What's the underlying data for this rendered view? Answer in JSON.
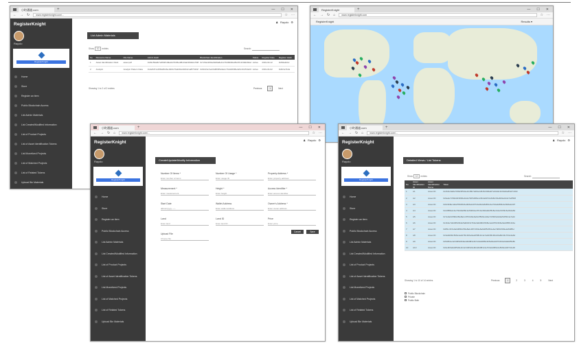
{
  "browser": {
    "tab_title": "小町通道.com",
    "tab_title_map": "RegisterKnight",
    "url_main": "www.registerknight.com/...",
    "url_map": "www.registerknight.com",
    "window_controls": [
      "—",
      "☐",
      "✕"
    ]
  },
  "app": {
    "brand": "RegisterKnight",
    "username": "Rayolo",
    "register_button": "RegisterKnight",
    "user_menu": "Rayolo"
  },
  "nav_left": [
    "Home",
    "Store",
    "Register an item",
    "Public Blockchain Access",
    "List Admin Materials",
    "List Created/Modified Information",
    "List of Product Projects",
    "List of Asset Identification Tokens",
    "List Monetized Projects",
    "List of Matched Projects",
    "List of Related Tokens",
    "Upload Bin Materials"
  ],
  "nav_bottom": [
    "Home",
    "Store",
    "Register an item",
    "Public Blockchain Access",
    "List Admin Materials",
    "List Created/Modified Information",
    "List of Product Projects",
    "List of Asset Identification Tokens",
    "List Monetized Projects",
    "List of Matched Projects",
    "List of Related Tokens",
    "Upload Bin Materials"
  ],
  "list_page": {
    "header": "List Admin Materials",
    "show_label": "Show",
    "show_value": "10",
    "entries_label": "entries",
    "search_label": "Search:",
    "columns": [
      "No",
      "Resource Name",
      "File Name",
      "Admin Hash",
      "Blockchain Identification",
      "Status",
      "Register Date",
      "Register Hash"
    ],
    "rows": [
      [
        "1",
        "Asset Identification Pack",
        "asset.pdf",
        "0x81c59a0b7e6f02f1d9a3c27b05e4f8c19ab360d2e7f48a1",
        "0x7c5a12f0be93d6a8e41c7f2d9b60a35e87c1f49d2b6a07e3",
        "Active",
        "2019-03-12",
        "0x5f2a9c1d"
      ],
      [
        "2",
        "Analytic",
        "Analytic Pattern Data",
        "0x3e8d71c2f09a5b46e18d3c7fa92b0e5d64c1a8f7b3029e6d",
        "0x9b1f4e7a2c6d80f35e9a1c7b4d206f8e3a5c19d7b0e6f42a",
        "Active",
        "2019-04-02",
        "0x8c3e7b2a"
      ]
    ],
    "footer_info": "Showing 1 to 2 of 2 entries",
    "pages": [
      "Previous",
      "1",
      "Next"
    ]
  },
  "form_page": {
    "header": "Create/Update/Modify Information",
    "col1": [
      {
        "label": "Number Of Items *",
        "value": "Enter number of items"
      },
      {
        "label": "Measurement *",
        "value": "Enter measurement"
      },
      {
        "label": "Start Date",
        "value": "dd/mm/yyyy --:--"
      },
      {
        "label": "Land",
        "value": "Enter land"
      },
      {
        "label": "Upload File",
        "value": "Choose file"
      }
    ],
    "col2": [
      {
        "label": "Number Of Usage *",
        "value": "Enter usage ID"
      },
      {
        "label": "Height *",
        "value": "Enter height"
      },
      {
        "label": "Wallet Address",
        "value": "Enter wallet address"
      },
      {
        "label": "Land ID",
        "value": "Enter land ID"
      }
    ],
    "col3": [
      {
        "label": "Property Address *",
        "value": "Enter property address"
      },
      {
        "label": "Access Identifier *",
        "value": "Enter access identifier"
      },
      {
        "label": "Owner's Address *",
        "value": "Enter owner address"
      },
      {
        "label": "Price",
        "value": "Enter price"
      }
    ],
    "cancel_label": "Cancel",
    "save_label": "Save"
  },
  "tokens_page": {
    "header": "Detailed Views / List Tokens",
    "show_label": "Show",
    "show_value": "10",
    "entries_label": "entries",
    "search_label": "Search:",
    "columns": [
      "No",
      "Asset Identification ID",
      "Asset Identification Name",
      "Token"
    ],
    "rows": [
      [
        "1",
        "A1",
        "Asset ID",
        "0x4fd1c0a8e7b6923f5d1e0c48b7a9f3e2d615c0b8a4f7e93d2c1b60a5e8f4d7c3b9"
      ],
      [
        "2",
        "A2",
        "Asset ID",
        "0x9a2e7c5b0d4f1836e9c2a7b05d3f8e1c6b4a9072e5d8c3f1a6b9e0d4c7a2f5b8"
      ],
      [
        "3",
        "A3",
        "Asset ID",
        "0x6c3b8e1d4a7f0925c6e3b8a1d4f7c0e9b2a5d8f1c4e7b0a3d6f9c2e5b8a1d4f7"
      ],
      [
        "4",
        "A4",
        "Asset ID",
        "0x2d5f8a1c4e7b0d3a6f9c2e5b8d1a4f7c0e3b6a9d2f5c8e1b4a7d0f3c6e9b2a5d"
      ],
      [
        "5",
        "A5",
        "Asset ID",
        "0x7e0a3c6f9b2d5e8a1c4f7b0d3e6a9c2f5b8e1d4a7c0f3b6e9d2a5c8f1b4e7a0c"
      ],
      [
        "6",
        "A6",
        "Asset ID",
        "0x1b4e7a0d3f6c9b2e5a8d1f4c7b0e3a6d9f2c5b8e1a4d7f0c3b6e9a2d5f8c1b4e"
      ],
      [
        "7",
        "A7",
        "Asset ID",
        "0x8f1c4b7e0a3d6f9c2b5e8a1d4f7c0b3e6a9d2f5c8b1e4a7d0f3c6b9e2a5d8f1c"
      ],
      [
        "8",
        "A8",
        "Asset ID",
        "0x3a6d9f2c5b8e1a4d7f0c3b6e9a2d5f8c1b4e7a0d3f6c9b2e5a8d1f4c7b0e3a6d"
      ],
      [
        "9",
        "A9",
        "Asset ID",
        "0x5c8b1e4a7d0f3c6b9e2a5d8f1c4b7e0a3d6f9c2b5e8a1d4f7c0b3e6a9d2f5c8b"
      ],
      [
        "10",
        "A10",
        "Asset ID",
        "0x0e3b6a9d2f5c8e1b4a7d0f3c6e9b2a5d8f1c4e7b0a3d6f9c2e5b8a1d4f7c0e3b"
      ]
    ],
    "footer_info": "Showing 1 to 10 of 14 entries",
    "pages": [
      "Previous",
      "1",
      "2",
      "3",
      "4",
      "5",
      "Next"
    ],
    "checkboxes": [
      "Public Blockchain",
      "Private",
      "Public Both"
    ]
  },
  "map_page": {
    "brand": "RegisterKnight",
    "menu": "Results ▾"
  },
  "colors": {
    "sidebar": "#3a3a3a",
    "header_box": "#444444",
    "accent": "#3b73e0",
    "map_water": "#aadaff",
    "map_land": "#e8ecd8",
    "token_row_tint": "#d6ebf5"
  },
  "icons": {
    "map_pins": "map-pin-icon",
    "avatar": "user-avatar-icon",
    "logo": "diamond-logo-icon"
  }
}
